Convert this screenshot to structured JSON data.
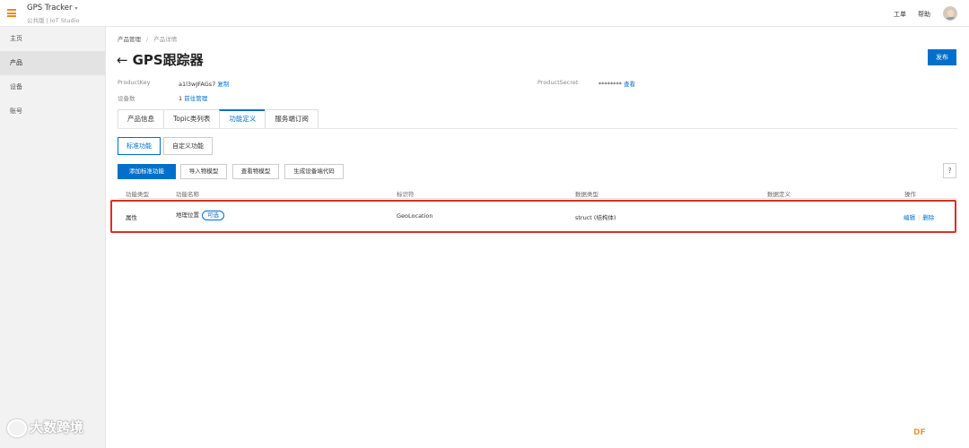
{
  "header": {
    "app_title": "GPS Tracker",
    "caret": "▾",
    "app_subtitle": "公共版 | IoT Studio",
    "ticket": "工单",
    "help": "帮助"
  },
  "sidebar": {
    "items": [
      {
        "label": "主页"
      },
      {
        "label": "产品"
      },
      {
        "label": "设备"
      },
      {
        "label": "账号"
      }
    ]
  },
  "breadcrumb": {
    "root": "产品管理",
    "sep": "/",
    "current": "产品详情"
  },
  "page": {
    "back_arrow": "←",
    "title": "GPS跟踪器",
    "publish": "发布"
  },
  "info": {
    "product_key_label": "ProductKey",
    "product_key_value": "a1l3wJFAGs7",
    "copy": "复制",
    "product_secret_label": "ProductSecret",
    "product_secret_value": "********",
    "view": "查看",
    "device_count_label": "设备数",
    "device_count_value": "1",
    "go_manage": "前往管理"
  },
  "tabs": [
    {
      "label": "产品信息"
    },
    {
      "label": "Topic类列表"
    },
    {
      "label": "功能定义"
    },
    {
      "label": "服务端订阅"
    }
  ],
  "subtabs": [
    {
      "label": "标准功能"
    },
    {
      "label": "自定义功能"
    }
  ],
  "actions": {
    "add": "添加标准功能",
    "import": "导入物模型",
    "view": "查看物模型",
    "gen_code": "生成设备端代码",
    "help": "?"
  },
  "table": {
    "headers": [
      "功能类型",
      "功能名称",
      "标识符",
      "数据类型",
      "数据定义",
      "操作"
    ],
    "rows": [
      {
        "type": "属性",
        "name": "地理位置",
        "badge": "可选",
        "identifier": "GeoLocation",
        "data_type": "struct (结构体)",
        "data_def": "",
        "edit": "编辑",
        "op_sep": "|",
        "delete": "删除"
      }
    ]
  },
  "watermark": {
    "text": "大数跨境",
    "corner": "DF"
  },
  "colors": {
    "primary": "#0070cc",
    "highlight": "#d93026",
    "menu_icon": "#f0861e"
  }
}
